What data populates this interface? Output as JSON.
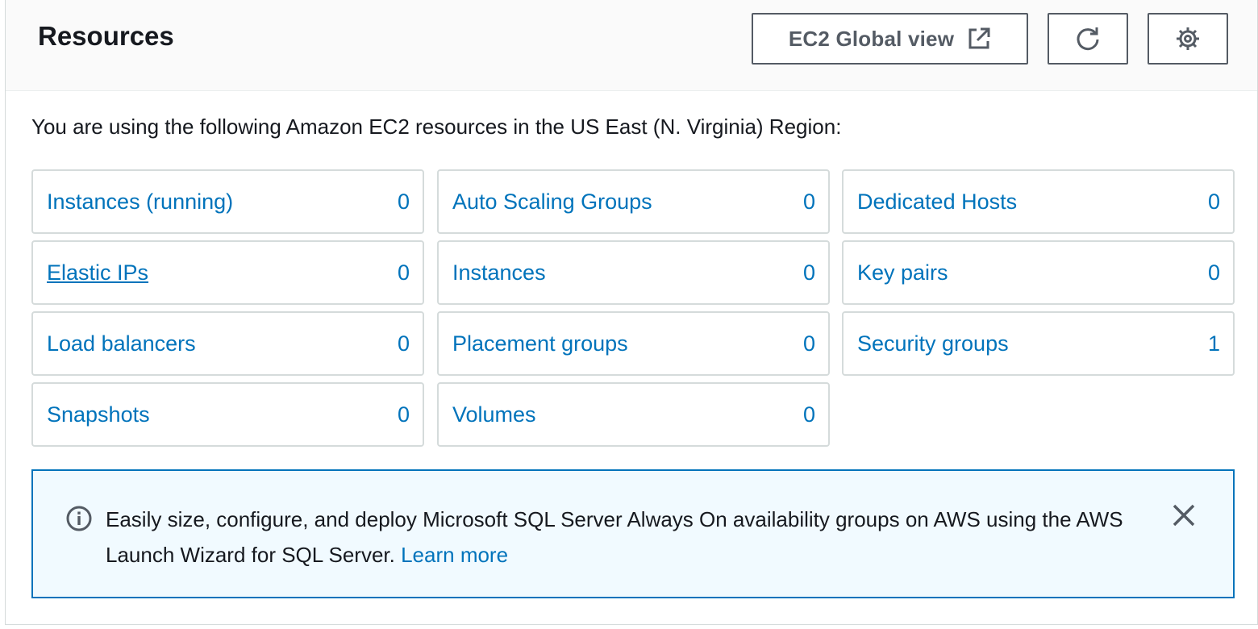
{
  "panel": {
    "title": "Resources",
    "global_view_label": "EC2 Global view",
    "icons": {
      "global_view": "external-link-icon",
      "refresh": "refresh-icon",
      "settings": "gear-icon"
    }
  },
  "intro": "You are using the following Amazon EC2 resources in the US East (N. Virginia) Region:",
  "resources": [
    {
      "label": "Instances (running)",
      "count": "0"
    },
    {
      "label": "Auto Scaling Groups",
      "count": "0"
    },
    {
      "label": "Dedicated Hosts",
      "count": "0"
    },
    {
      "label": "Elastic IPs",
      "count": "0"
    },
    {
      "label": "Instances",
      "count": "0"
    },
    {
      "label": "Key pairs",
      "count": "0"
    },
    {
      "label": "Load balancers",
      "count": "0"
    },
    {
      "label": "Placement groups",
      "count": "0"
    },
    {
      "label": "Security groups",
      "count": "1"
    },
    {
      "label": "Snapshots",
      "count": "0"
    },
    {
      "label": "Volumes",
      "count": "0"
    }
  ],
  "alert": {
    "message": "Easily size, configure, and deploy Microsoft SQL Server Always On availability groups on AWS using the AWS Launch Wizard for SQL Server.",
    "link": "Learn more",
    "icons": {
      "info": "info-icon",
      "close": "close-icon"
    }
  },
  "colors": {
    "link": "#0073bb",
    "alert_bg": "#f1faff",
    "border": "#d5dbdb",
    "button_text": "#545b64"
  }
}
